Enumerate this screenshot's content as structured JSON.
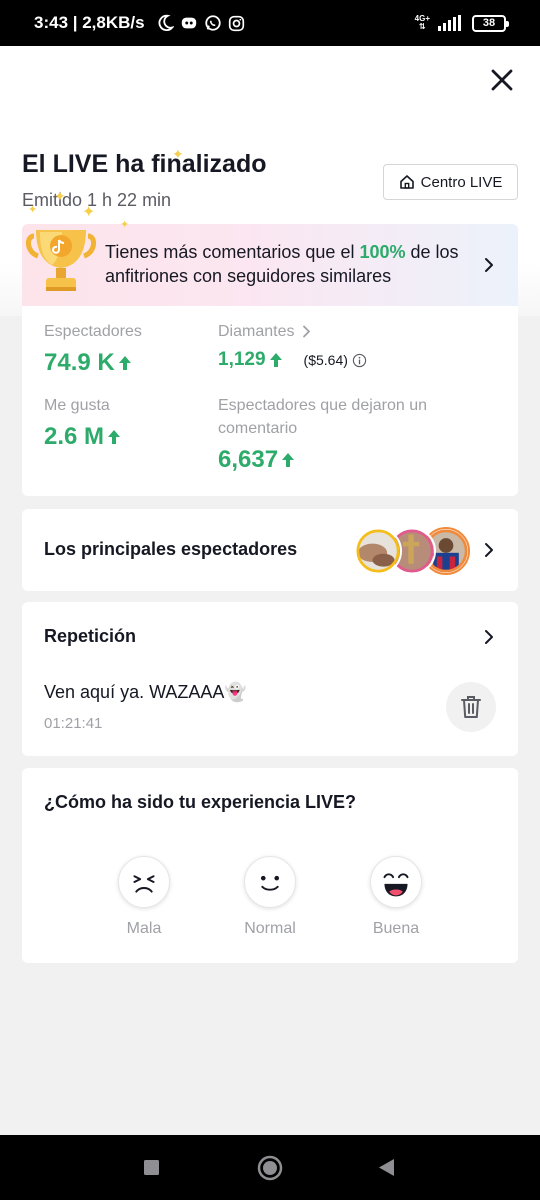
{
  "status_bar": {
    "time_speed": "3:43 | 2,8KB/s",
    "network": "4G+",
    "battery": "38"
  },
  "header": {
    "title": "El LIVE ha finalizado",
    "subtitle": "Emitido 1 h 22 min",
    "centro_label": "Centro LIVE"
  },
  "banner": {
    "text_before": "Tienes más comentarios que el ",
    "highlight": "100%",
    "text_after": " de los anfitriones con seguidores similares"
  },
  "stats": {
    "viewers_label": "Espectadores",
    "viewers_value": "74.9 K",
    "diamonds_label": "Diamantes",
    "diamonds_value": "1,129",
    "diamonds_usd": "($5.64)",
    "likes_label": "Me gusta",
    "likes_value": "2.6 M",
    "commenters_label": "Espectadores que dejaron un comentario",
    "commenters_value": "6,637"
  },
  "top_viewers": {
    "title": "Los principales espectadores"
  },
  "replay": {
    "title": "Repetición",
    "clip_text": "Ven aquí ya. WAZAAA👻",
    "clip_time": "01:21:41"
  },
  "experience": {
    "question": "¿Cómo ha sido tu experiencia LIVE?",
    "options": [
      "Mala",
      "Normal",
      "Buena"
    ]
  },
  "colors": {
    "accent_green": "#2dab6a",
    "background": "#f1f1f2"
  }
}
